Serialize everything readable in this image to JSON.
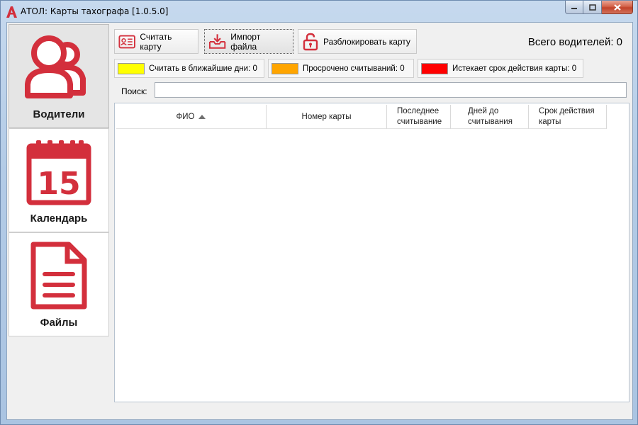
{
  "window": {
    "title": "АТОЛ: Карты тахографа [1.0.5.0]",
    "brand_color": "#d32f3c"
  },
  "sidebar": {
    "items": [
      {
        "label": "Водители",
        "icon": "users-icon",
        "active": true
      },
      {
        "label": "Календарь",
        "icon": "calendar-icon",
        "active": false,
        "day": "15"
      },
      {
        "label": "Файлы",
        "icon": "document-icon",
        "active": false
      }
    ]
  },
  "toolbar": {
    "read_card": "Считать карту",
    "import_file": "Импорт файла",
    "unlock_card": "Разблокировать карту",
    "total_drivers": "Всего водителей: 0"
  },
  "legend": [
    {
      "label": "Считать в ближайшие дни: 0",
      "color": "#ffff00"
    },
    {
      "label": "Просрочено считываний: 0",
      "color": "#ffa500"
    },
    {
      "label": "Истекает срок действия карты: 0",
      "color": "#ff0000"
    }
  ],
  "search": {
    "label": "Поиск:",
    "value": ""
  },
  "table": {
    "columns": [
      {
        "label": "ФИО",
        "sorted": "asc"
      },
      {
        "label": "Номер карты"
      },
      {
        "label": "Последнее считывание"
      },
      {
        "label": "Дней до считывания"
      },
      {
        "label": "Срок действия карты"
      }
    ],
    "rows": []
  }
}
